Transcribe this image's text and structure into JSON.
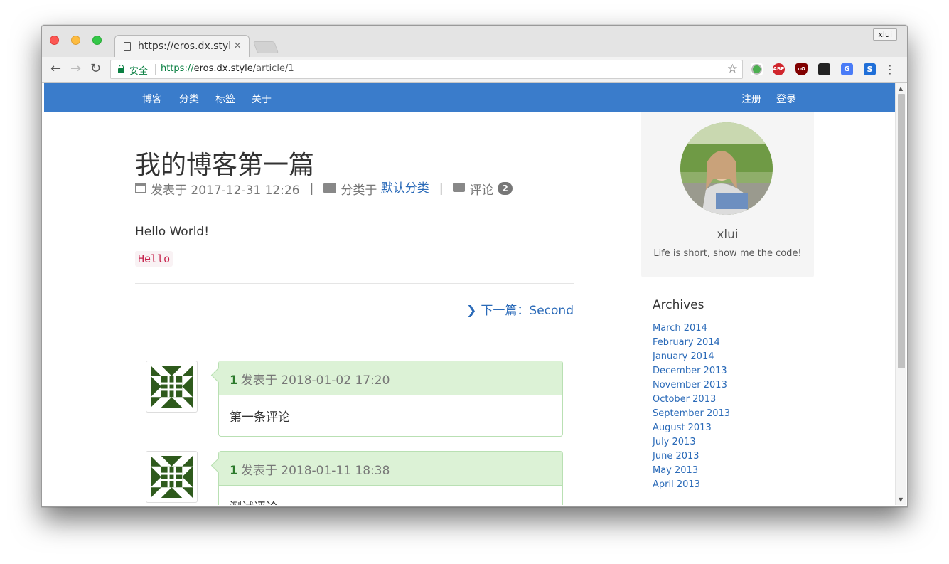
{
  "browser": {
    "tab_title": "https://eros.dx.style",
    "tab_close": "×",
    "profile_name": "xlui",
    "secure_label": "安全",
    "url_scheme": "https://",
    "url_host": "eros.dx.style",
    "url_path": "/article/1",
    "back": "←",
    "forward": "→",
    "reload": "↻",
    "bookmark": "☆",
    "menu": "⋮",
    "extensions": [
      {
        "name": "circle-ext",
        "color": "#4caf50",
        "label": ""
      },
      {
        "name": "adblock-plus",
        "color": "#d0262d",
        "label": "ABP"
      },
      {
        "name": "ublock-origin",
        "color": "#800000",
        "label": "uO"
      },
      {
        "name": "tampermonkey",
        "color": "#222222",
        "label": ""
      },
      {
        "name": "google-translate",
        "color": "#4a7cf7",
        "label": "G"
      },
      {
        "name": "s-extension",
        "color": "#1f6fd8",
        "label": "S"
      }
    ]
  },
  "nav": {
    "left": [
      "博客",
      "分类",
      "标签",
      "关于"
    ],
    "right": [
      "注册",
      "登录"
    ]
  },
  "post": {
    "title": "我的博客第一篇",
    "date_label": "发表于 2017-12-31 12:26",
    "category_prefix": "分类于",
    "category": "默认分类",
    "comments_label": "评论",
    "comments_count": "2",
    "separator": "|",
    "body": "Hello World!",
    "code": "Hello",
    "next_label": "下一篇：Second",
    "next_chevron": "❯"
  },
  "comments": [
    {
      "floor": "1",
      "meta": "发表于 2018-01-02 17:20",
      "text": "第一条评论"
    },
    {
      "floor": "1",
      "meta": "发表于 2018-01-11 18:38",
      "text": "测试评论"
    }
  ],
  "sidebar": {
    "name": "xlui",
    "bio": "Life is short, show me the code!",
    "archives_title": "Archives",
    "archives": [
      "March 2014",
      "February 2014",
      "January 2014",
      "December 2013",
      "November 2013",
      "October 2013",
      "September 2013",
      "August 2013",
      "July 2013",
      "June 2013",
      "May 2013",
      "April 2013"
    ]
  }
}
